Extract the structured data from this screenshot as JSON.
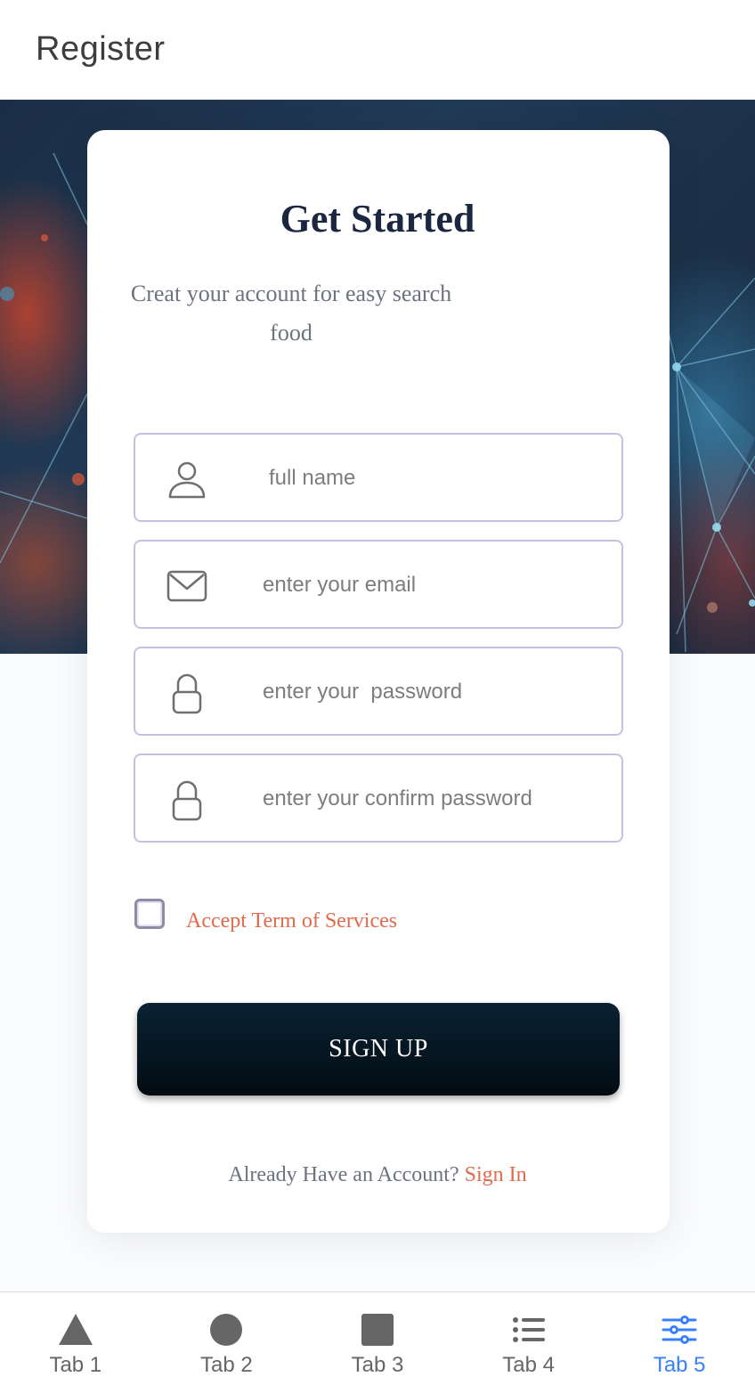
{
  "header": {
    "title": "Register"
  },
  "card": {
    "title": "Get Started",
    "subtitle": "Creat your account for easy search food"
  },
  "form": {
    "fields": [
      {
        "placeholder": "full name",
        "icon": "person-icon"
      },
      {
        "placeholder": "enter your email",
        "icon": "mail-icon"
      },
      {
        "placeholder": "enter your  password",
        "icon": "lock-icon"
      },
      {
        "placeholder": "enter your confirm password",
        "icon": "lock-icon"
      }
    ],
    "terms_label": "Accept Term of Services",
    "terms_checked": false,
    "submit_label": "SIGN UP",
    "signin_prompt": "Already Have an Account?",
    "signin_link": "Sign In"
  },
  "tabs": [
    {
      "label": "Tab 1",
      "icon": "triangle-icon",
      "active": false
    },
    {
      "label": "Tab 2",
      "icon": "circle-icon",
      "active": false
    },
    {
      "label": "Tab 3",
      "icon": "square-icon",
      "active": false
    },
    {
      "label": "Tab 4",
      "icon": "list-icon",
      "active": false
    },
    {
      "label": "Tab 5",
      "icon": "sliders-icon",
      "active": true
    }
  ],
  "colors": {
    "accent": "#e26a4a",
    "tab_active": "#3880ff",
    "tab_inactive": "#666666",
    "button_dark": "#020b12"
  }
}
